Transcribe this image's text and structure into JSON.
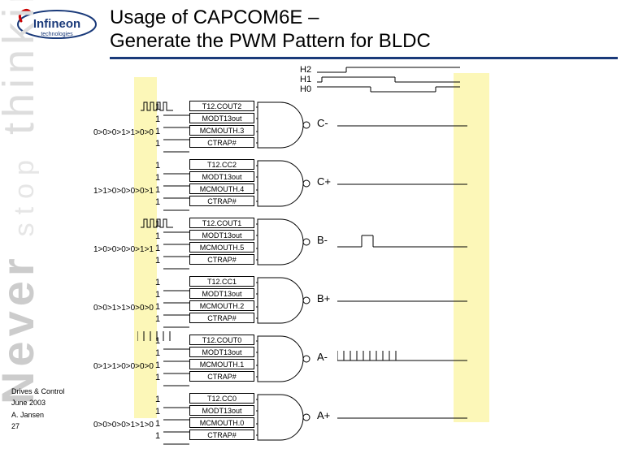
{
  "header": {
    "title_line1": "Usage of CAPCOM6E –",
    "title_line2": "Generate the PWM Pattern for BLDC",
    "logo_brand": "Infineon",
    "logo_sub": "technologies"
  },
  "sidebar": {
    "never": "Never",
    "stop": "stop",
    "thinking": "thinking"
  },
  "footer": {
    "dept": "Drives & Control",
    "date": "June 2003",
    "author": "A. Jansen",
    "page": "27"
  },
  "hall": {
    "h2": "H2",
    "h1": "H1",
    "h0": "H0"
  },
  "groups": [
    {
      "out": "C-",
      "seq": "0>0>0>1>1>0>0",
      "signals": [
        "T12.COUT2",
        "MODT13out",
        "MCMOUTH.3",
        "CTRAP#"
      ],
      "wave": true
    },
    {
      "out": "C+",
      "seq": "1>1>0>0>0>0>1",
      "signals": [
        "T12.CC2",
        "MODT13out",
        "MCMOUTH.4",
        "CTRAP#"
      ],
      "wave": false
    },
    {
      "out": "B-",
      "seq": "1>0>0>0>0>1>1",
      "signals": [
        "T12.COUT1",
        "MODT13out",
        "MCMOUTH.5",
        "CTRAP#"
      ],
      "wave": true
    },
    {
      "out": "B+",
      "seq": "0>0>1>1>0>0>0",
      "signals": [
        "T12.CC1",
        "MODT13out",
        "MCMOUTH.2",
        "CTRAP#"
      ],
      "wave": false
    },
    {
      "out": "A-",
      "seq": "0>1>1>0>0>0>0",
      "signals": [
        "T12.COUT0",
        "MODT13out",
        "MCMOUTH.1",
        "CTRAP#"
      ],
      "wave": false
    },
    {
      "out": "A+",
      "seq": "0>0>0>0>1>1>0",
      "signals": [
        "T12.CC0",
        "MODT13out",
        "MCMOUTH.0",
        "CTRAP#"
      ],
      "wave": false
    }
  ]
}
